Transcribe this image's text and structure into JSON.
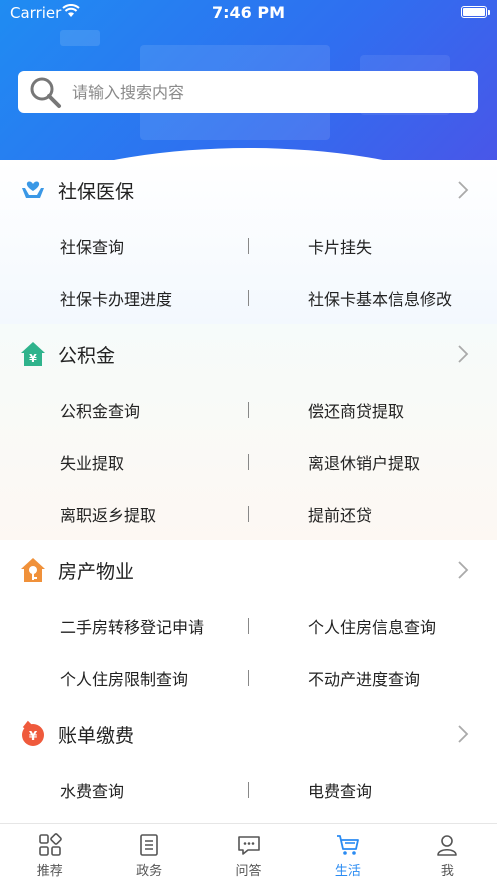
{
  "status_bar": {
    "carrier": "Carrier",
    "time": "7:46 PM"
  },
  "search": {
    "placeholder": "请输入搜索内容"
  },
  "sections": [
    {
      "title": "社保医保",
      "icon": "hands-heart-icon",
      "rows": [
        {
          "left": "社保查询",
          "right": "卡片挂失"
        },
        {
          "left": "社保卡办理进度",
          "right": "社保卡基本信息修改"
        }
      ]
    },
    {
      "title": "公积金",
      "icon": "house-yuan-icon",
      "rows": [
        {
          "left": "公积金查询",
          "right": "偿还商贷提取"
        },
        {
          "left": "失业提取",
          "right": "离退休销户提取"
        },
        {
          "left": "离职返乡提取",
          "right": "提前还贷"
        }
      ]
    },
    {
      "title": "房产物业",
      "icon": "house-key-icon",
      "rows": [
        {
          "left": "二手房转移登记申请",
          "right": "个人住房信息查询"
        },
        {
          "left": "个人住房限制查询",
          "right": "不动产进度查询"
        }
      ]
    },
    {
      "title": "账单缴费",
      "icon": "bill-badge-icon",
      "rows": [
        {
          "left": "水费查询",
          "right": "电费查询"
        }
      ]
    }
  ],
  "tabbar": {
    "items": [
      {
        "label": "推荐",
        "icon": "grid-icon"
      },
      {
        "label": "政务",
        "icon": "document-icon"
      },
      {
        "label": "问答",
        "icon": "chat-icon"
      },
      {
        "label": "生活",
        "icon": "cart-icon",
        "active": true
      },
      {
        "label": "我",
        "icon": "person-icon"
      }
    ]
  },
  "colors": {
    "accent": "#2a8bf2",
    "hero_start": "#1f8cf2",
    "hero_end": "#4a55e8"
  }
}
